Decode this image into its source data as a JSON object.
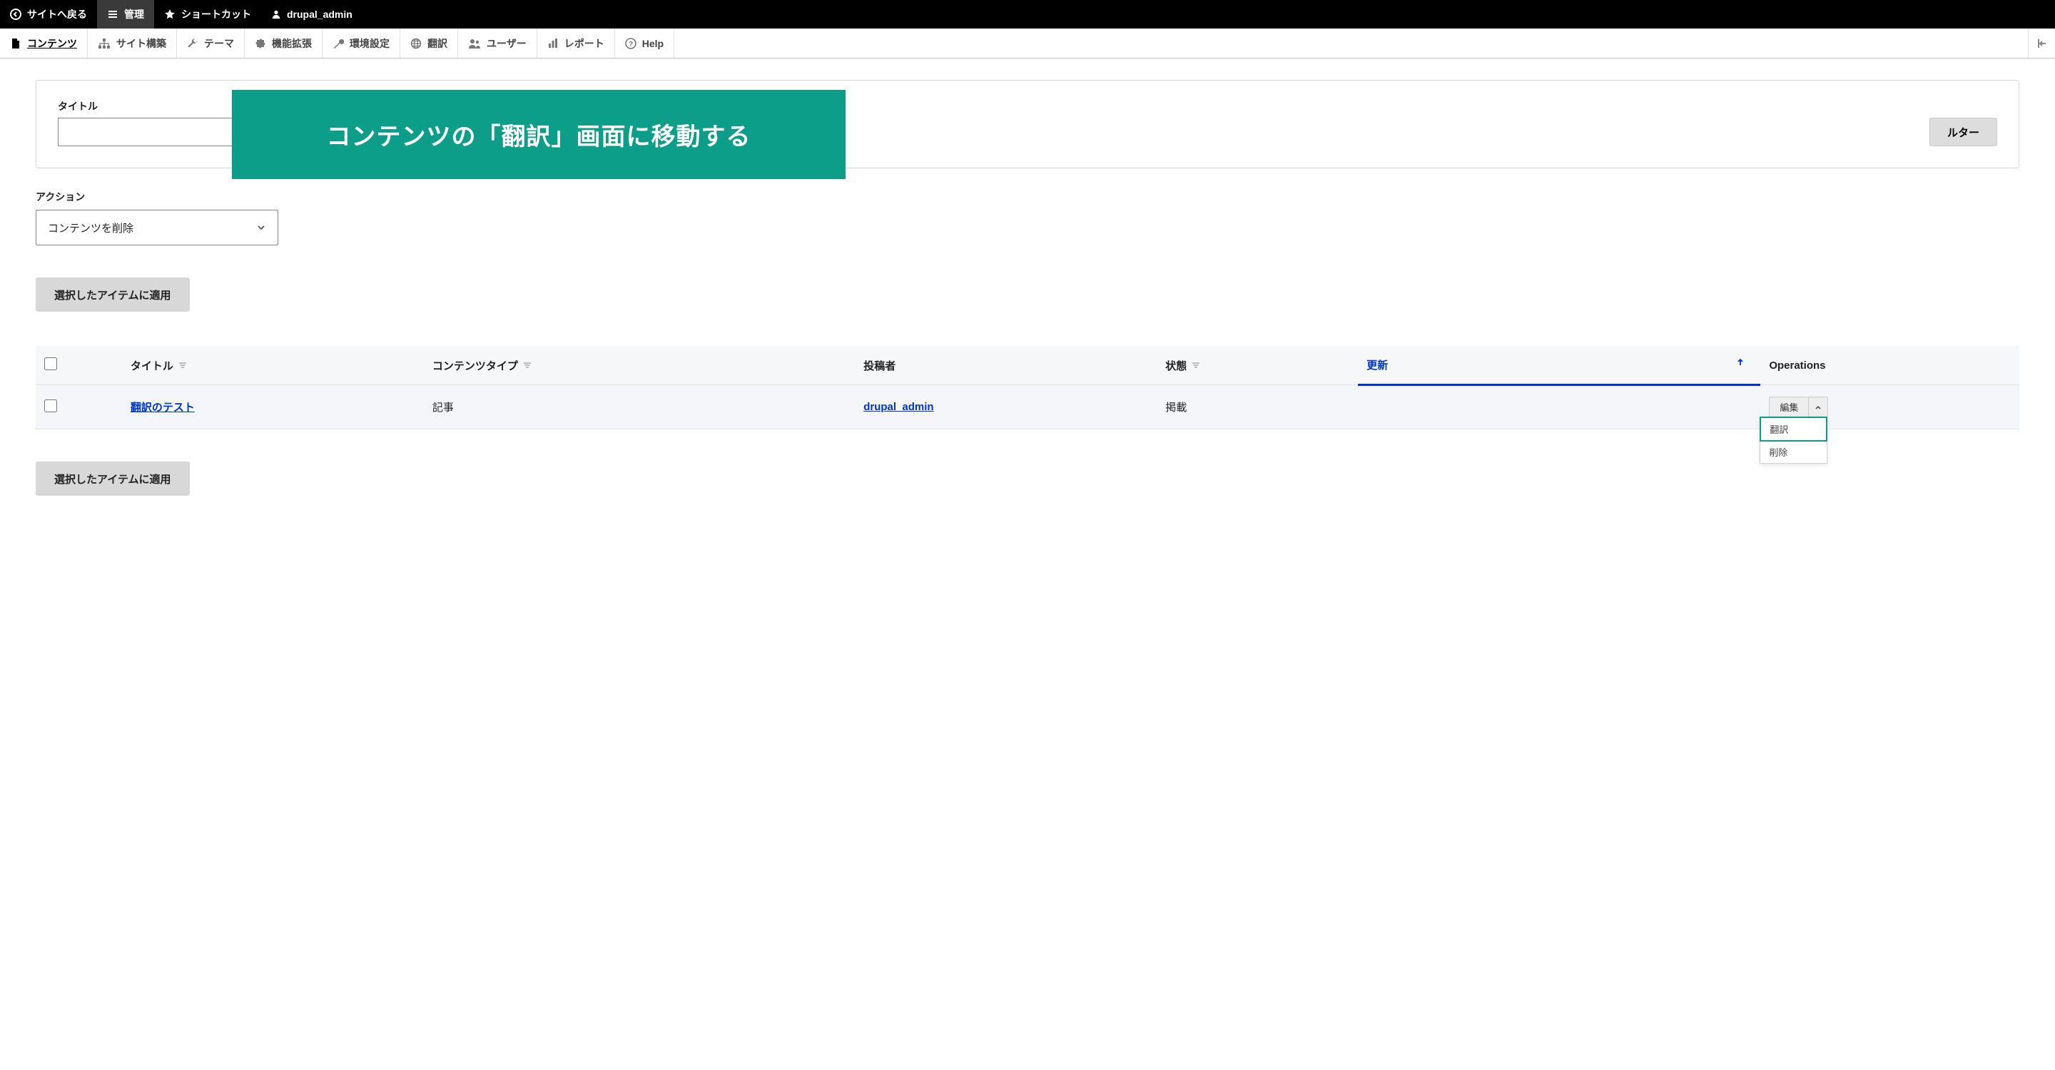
{
  "top_toolbar": {
    "back": "サイトへ戻る",
    "manage": "管理",
    "shortcuts": "ショートカット",
    "user": "drupal_admin"
  },
  "admin_toolbar": {
    "content": "コンテンツ",
    "structure": "サイト構築",
    "appearance": "テーマ",
    "extend": "機能拡張",
    "configuration": "環境設定",
    "translate": "翻訳",
    "people": "ユーザー",
    "reports": "レポート",
    "help": "Help"
  },
  "overlay_banner": "コンテンツの「翻訳」画面に移動する",
  "filters": {
    "title_label": "タイトル",
    "title_value": "",
    "filter_button": "ルター"
  },
  "action": {
    "label": "アクション",
    "selected": "コンテンツを削除"
  },
  "apply_button": "選択したアイテムに適用",
  "table": {
    "headers": {
      "title": "タイトル",
      "content_type": "コンテンツタイプ",
      "author": "投稿者",
      "state": "状態",
      "updated": "更新",
      "operations": "Operations"
    },
    "rows": [
      {
        "title": "翻訳のテスト",
        "content_type": "記事",
        "author": "drupal_admin",
        "state": "掲載",
        "updated": ""
      }
    ],
    "ops": {
      "edit": "編集",
      "translate": "翻訳",
      "delete": "削除"
    }
  }
}
